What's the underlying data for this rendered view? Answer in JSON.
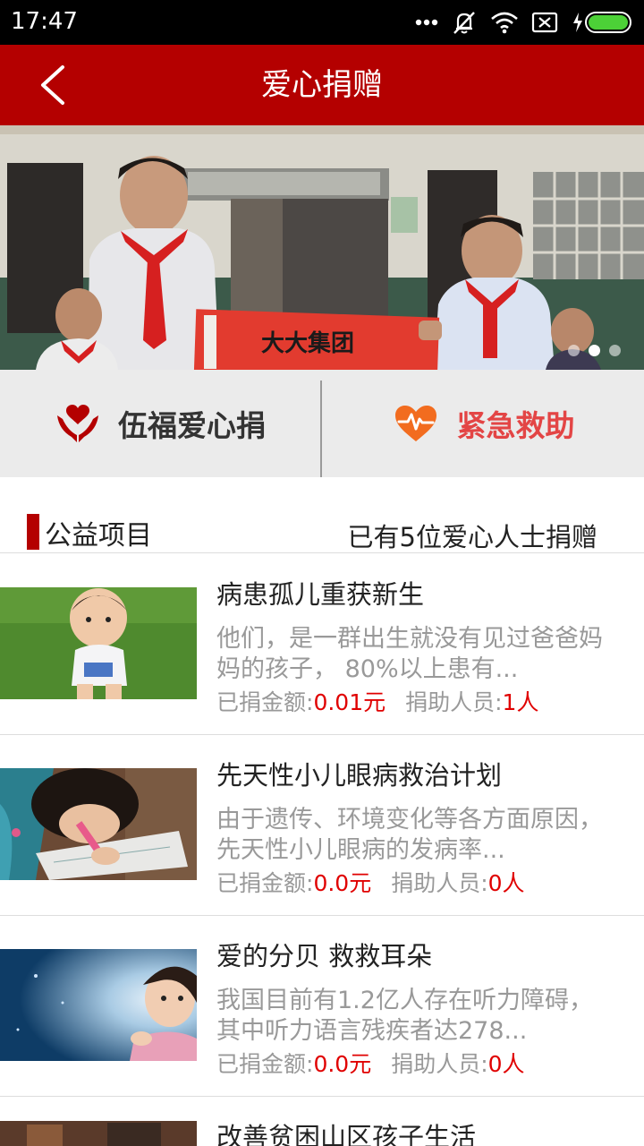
{
  "status_bar": {
    "time": "17:47"
  },
  "header": {
    "title": "爱心捐赠"
  },
  "banner": {
    "sign_text": "大大集团",
    "page_count": 3,
    "active_index": 1
  },
  "quick_actions": {
    "left": {
      "label": "伍福爱心捐",
      "icon": "heart-hands-icon",
      "color": "#b40000"
    },
    "right": {
      "label": "紧急救助",
      "icon": "heartbeat-icon",
      "color": "#e34545"
    }
  },
  "section": {
    "title": "公益项目",
    "donor_count_text": "已有5位爱心人士捐赠"
  },
  "projects": [
    {
      "title": "病患孤儿重获新生",
      "desc": "他们，是一群出生就没有见过爸爸妈妈的孩子， 80%以上患有...",
      "amount_label": "已捐金额:",
      "amount": "0.01元",
      "people_label": "捐助人员:",
      "people": "1人"
    },
    {
      "title": "先天性小儿眼病救治计划",
      "desc": "由于遗传、环境变化等各方面原因，先天性小儿眼病的发病率...",
      "amount_label": "已捐金额:",
      "amount": "0.0元",
      "people_label": "捐助人员:",
      "people": "0人"
    },
    {
      "title": "爱的分贝 救救耳朵",
      "desc": "我国目前有1.2亿人存在听力障碍，其中听力语言残疾者达278...",
      "amount_label": "已捐金额:",
      "amount": "0.0元",
      "people_label": "捐助人员:",
      "people": "0人"
    },
    {
      "title": "改善贫困山区孩子生活"
    }
  ]
}
